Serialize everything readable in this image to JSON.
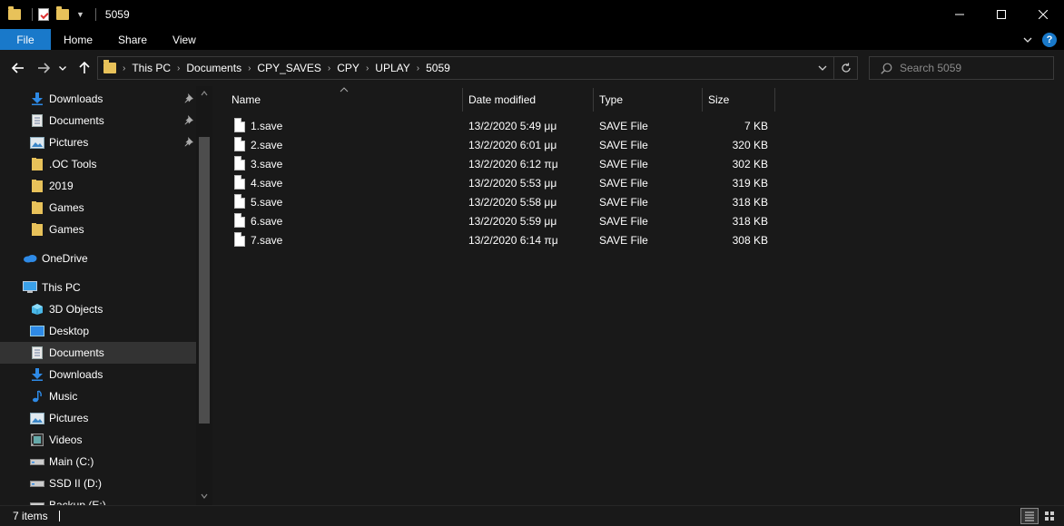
{
  "window": {
    "title": "5059"
  },
  "ribbon": {
    "tabs": [
      "File",
      "Home",
      "Share",
      "View"
    ],
    "help_label": "?"
  },
  "address": {
    "breadcrumbs": [
      "This PC",
      "Documents",
      "CPY_SAVES",
      "CPY",
      "UPLAY",
      "5059"
    ]
  },
  "search": {
    "placeholder": "Search 5059"
  },
  "nav_pane": {
    "items": [
      {
        "label": "Downloads",
        "icon": "download-icon",
        "pinned": true
      },
      {
        "label": "Documents",
        "icon": "document-icon",
        "pinned": true
      },
      {
        "label": "Pictures",
        "icon": "pictures-icon",
        "pinned": true
      },
      {
        "label": ".OC Tools",
        "icon": "folder-icon",
        "pinned": false
      },
      {
        "label": "2019",
        "icon": "folder-icon",
        "pinned": false
      },
      {
        "label": "Games",
        "icon": "folder-icon",
        "pinned": false
      },
      {
        "label": "Games",
        "icon": "folder-icon",
        "pinned": false
      },
      {
        "label": "OneDrive",
        "icon": "cloud-icon",
        "pinned": false
      },
      {
        "label": "This PC",
        "icon": "computer-icon",
        "pinned": false
      },
      {
        "label": "3D Objects",
        "icon": "cube-icon",
        "pinned": false
      },
      {
        "label": "Desktop",
        "icon": "desktop-icon",
        "pinned": false
      },
      {
        "label": "Documents",
        "icon": "document-icon",
        "pinned": false,
        "selected": true
      },
      {
        "label": "Downloads",
        "icon": "download-icon",
        "pinned": false
      },
      {
        "label": "Music",
        "icon": "music-icon",
        "pinned": false
      },
      {
        "label": "Pictures",
        "icon": "pictures-icon",
        "pinned": false
      },
      {
        "label": "Videos",
        "icon": "video-icon",
        "pinned": false
      },
      {
        "label": "Main (C:)",
        "icon": "drive-icon",
        "pinned": false
      },
      {
        "label": "SSD II (D:)",
        "icon": "drive-icon",
        "pinned": false
      },
      {
        "label": "Backup (E:)",
        "icon": "drive-icon",
        "pinned": false
      }
    ]
  },
  "file_list": {
    "columns": [
      "Name",
      "Date modified",
      "Type",
      "Size"
    ],
    "rows": [
      {
        "name": "1.save",
        "date": "13/2/2020 5:49 μμ",
        "type": "SAVE File",
        "size": "7 KB"
      },
      {
        "name": "2.save",
        "date": "13/2/2020 6:01 μμ",
        "type": "SAVE File",
        "size": "320 KB"
      },
      {
        "name": "3.save",
        "date": "13/2/2020 6:12 πμ",
        "type": "SAVE File",
        "size": "302 KB"
      },
      {
        "name": "4.save",
        "date": "13/2/2020 5:53 μμ",
        "type": "SAVE File",
        "size": "319 KB"
      },
      {
        "name": "5.save",
        "date": "13/2/2020 5:58 μμ",
        "type": "SAVE File",
        "size": "318 KB"
      },
      {
        "name": "6.save",
        "date": "13/2/2020 5:59 μμ",
        "type": "SAVE File",
        "size": "318 KB"
      },
      {
        "name": "7.save",
        "date": "13/2/2020 6:14 πμ",
        "type": "SAVE File",
        "size": "308 KB"
      }
    ]
  },
  "status": {
    "item_count": "7 items"
  },
  "colors": {
    "accent": "#1979ca",
    "folder": "#e8c25a",
    "background": "#191919"
  }
}
